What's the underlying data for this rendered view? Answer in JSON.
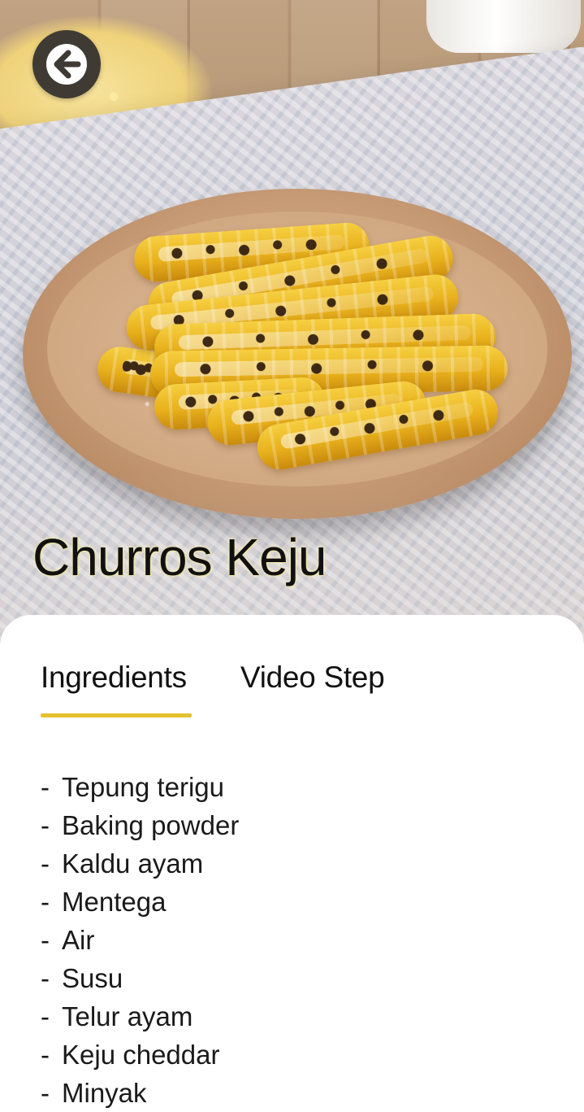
{
  "hero": {
    "photo_subject": "plate of cheese churros",
    "back_icon": "arrow-left-icon"
  },
  "recipe": {
    "title": "Churros Keju"
  },
  "tabs": [
    {
      "label": "Ingredients",
      "active": true
    },
    {
      "label": "Video Step",
      "active": false
    }
  ],
  "ingredients": {
    "bullet": "-",
    "items": [
      "Tepung terigu",
      "Baking powder",
      "Kaldu ayam",
      "Mentega",
      "Air",
      "Susu",
      "Telur ayam",
      "Keju cheddar",
      "Minyak"
    ]
  },
  "colors": {
    "accent_underline": "#e4c22f",
    "back_button_bg": "#3f3b34",
    "text": "#111111"
  }
}
